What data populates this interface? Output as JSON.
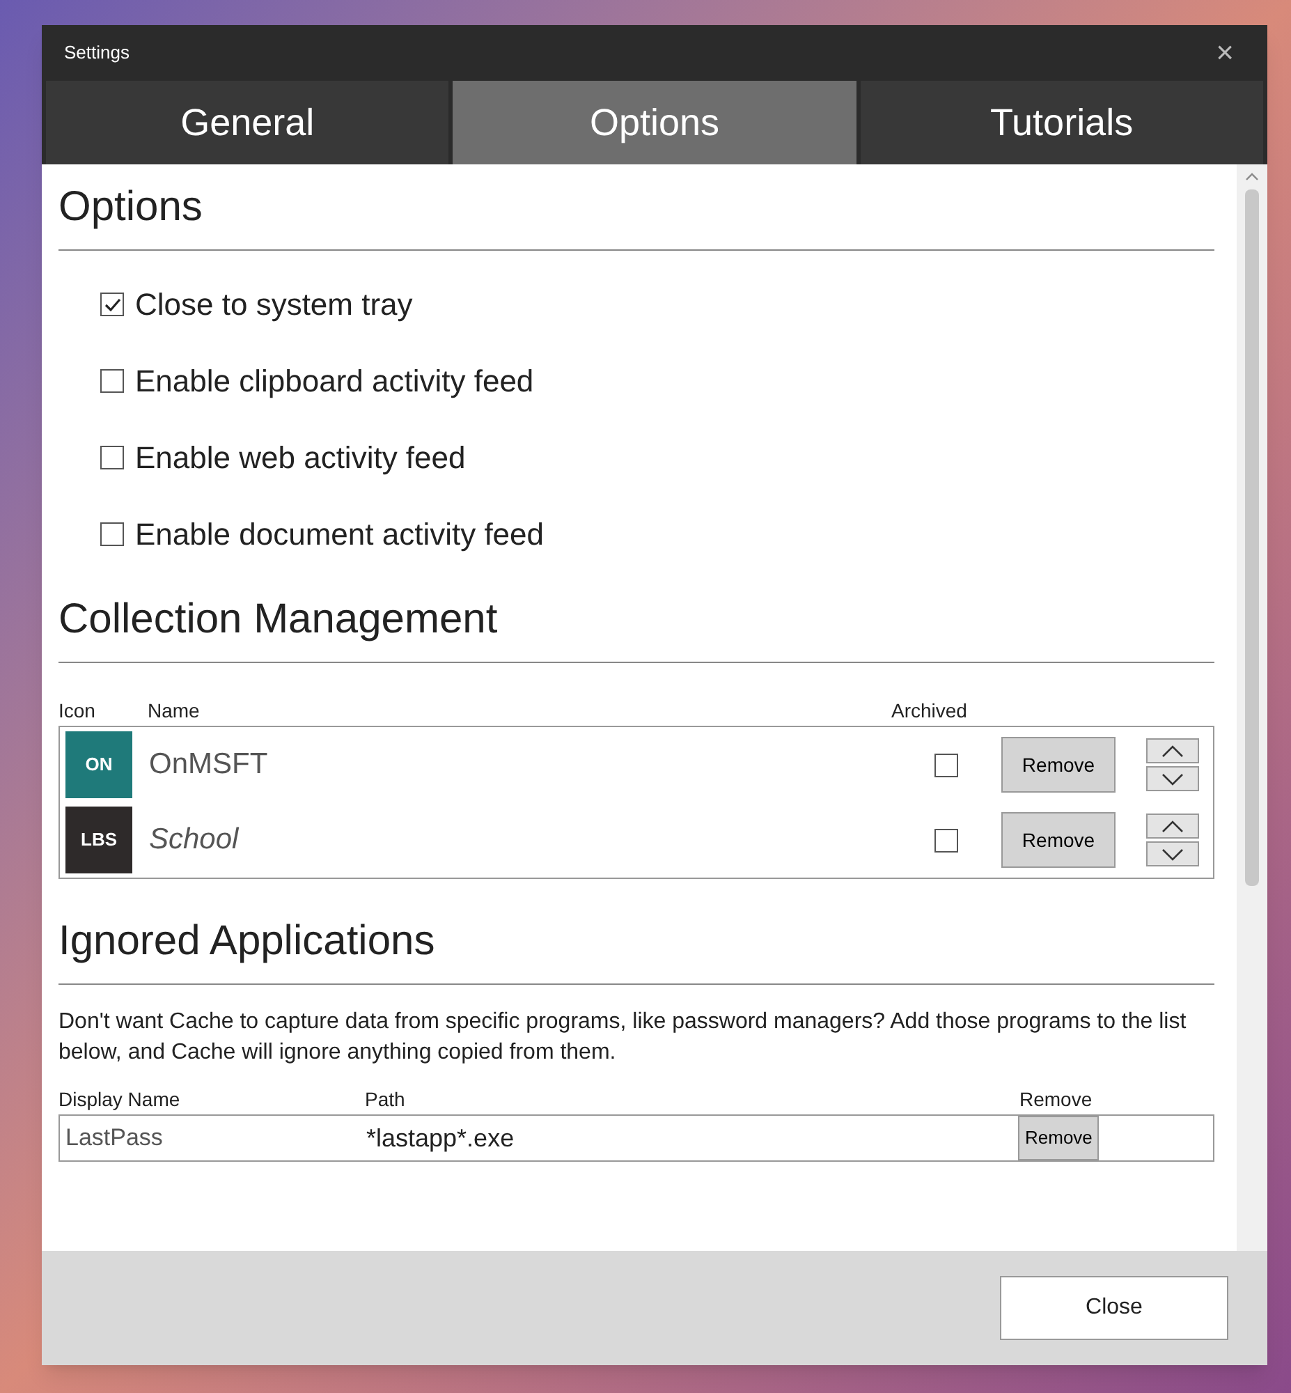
{
  "window": {
    "title": "Settings",
    "close": "×"
  },
  "tabs": [
    {
      "label": "General",
      "selected": false
    },
    {
      "label": "Options",
      "selected": true
    },
    {
      "label": "Tutorials",
      "selected": false
    }
  ],
  "options": {
    "heading": "Options",
    "items": [
      {
        "label": "Close to system tray",
        "checked": true
      },
      {
        "label": "Enable clipboard activity feed",
        "checked": false
      },
      {
        "label": "Enable web activity feed",
        "checked": false
      },
      {
        "label": "Enable document activity feed",
        "checked": false
      }
    ]
  },
  "collections": {
    "heading": "Collection Management",
    "columns": [
      "Icon",
      "Name",
      "Archived"
    ],
    "rows": [
      {
        "icon_text": "ON",
        "color": "#1f7a7a",
        "name": "OnMSFT",
        "archived": false,
        "button": "Remove"
      },
      {
        "icon_text": "LBS",
        "color": "#2e2a2a",
        "name": "School",
        "archived": false,
        "button": "Remove"
      }
    ]
  },
  "ignored": {
    "heading": "Ignored Applications",
    "description": "Don't want Cache to capture data from specific programs, like password managers? Add those programs to the list below, and Cache will ignore anything copied from them.",
    "columns": [
      "Display Name",
      "Path",
      "Remove"
    ],
    "rows": [
      {
        "display_name": "LastPass",
        "path": "*lastapp*.exe",
        "button": "Remove"
      }
    ]
  },
  "footer": {
    "button": "Close"
  }
}
